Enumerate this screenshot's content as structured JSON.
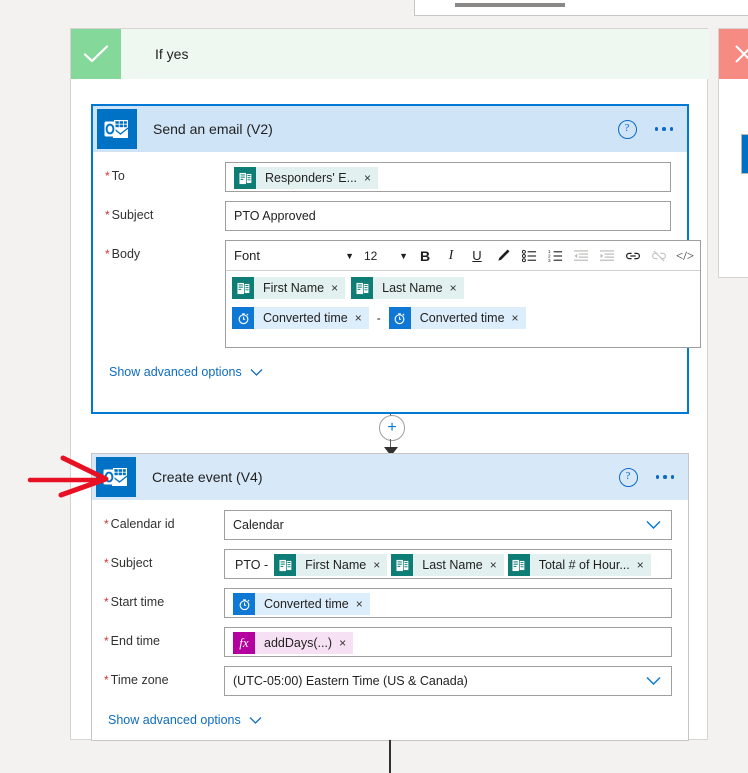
{
  "branches": {
    "yes": {
      "label": "If yes",
      "icon": "check-icon"
    },
    "no": {
      "label": "",
      "icon": "close-icon"
    }
  },
  "email_card": {
    "title": "Send an email (V2)",
    "icon": "outlook-icon",
    "help_icon": "help-icon",
    "more_icon": "ellipsis-icon",
    "fields": {
      "to": {
        "label": "To",
        "required": "*",
        "tokens": [
          {
            "text": "Responders' E...",
            "type": "forms",
            "icon": "forms-icon",
            "remove": "×"
          }
        ]
      },
      "subject": {
        "label": "Subject",
        "required": "*",
        "value": "PTO Approved"
      },
      "body": {
        "label": "Body",
        "required": "*",
        "toolbar": {
          "font_label": "Font",
          "font_caret": "▼",
          "size_label": "12",
          "size_caret": "▼",
          "bold": "B",
          "italic": "I",
          "underline": "U",
          "highlight_icon": "pen-icon",
          "bullet_list_icon": "bullet-list-icon",
          "numbered_list_icon": "numbered-list-icon",
          "outdent_icon": "outdent-icon",
          "indent_icon": "indent-icon",
          "link_icon": "link-icon",
          "unlink_icon": "unlink-icon",
          "code_icon": "code-view-icon",
          "code_label": "</>"
        },
        "lines": [
          {
            "tokens": [
              {
                "text": "First Name",
                "type": "forms",
                "icon": "forms-icon",
                "remove": "×"
              },
              {
                "text": "Last Name",
                "type": "forms",
                "icon": "forms-icon",
                "remove": "×"
              }
            ]
          },
          {
            "tokens": [
              {
                "text": "Converted time",
                "type": "time",
                "icon": "clock-icon",
                "remove": "×"
              },
              {
                "separator": "-"
              },
              {
                "text": "Converted time",
                "type": "time",
                "icon": "clock-icon",
                "remove": "×"
              }
            ]
          }
        ]
      }
    },
    "advanced_label": "Show advanced options",
    "advanced_caret": "⌄"
  },
  "connector": {
    "plus": "+",
    "plus_icon": "add-step-icon",
    "arrow_icon": "arrow-down-icon"
  },
  "event_card": {
    "title": "Create event (V4)",
    "icon": "outlook-icon",
    "help_icon": "help-icon",
    "more_icon": "ellipsis-icon",
    "fields": {
      "calendar_id": {
        "label": "Calendar id",
        "required": "*",
        "value": "Calendar",
        "caret": "⌄"
      },
      "subject": {
        "label": "Subject",
        "required": "*",
        "prefix": "PTO -",
        "tokens": [
          {
            "text": "First Name",
            "type": "forms",
            "icon": "forms-icon",
            "remove": "×"
          },
          {
            "text": "Last Name",
            "type": "forms",
            "icon": "forms-icon",
            "remove": "×"
          },
          {
            "text": "Total # of Hour...",
            "type": "forms",
            "icon": "forms-icon",
            "remove": "×"
          }
        ]
      },
      "start_time": {
        "label": "Start time",
        "required": "*",
        "tokens": [
          {
            "text": "Converted time",
            "type": "time",
            "icon": "clock-icon",
            "remove": "×"
          }
        ]
      },
      "end_time": {
        "label": "End time",
        "required": "*",
        "tokens": [
          {
            "text": "addDays(...)",
            "type": "expr",
            "icon": "function-icon",
            "glyph": "fx",
            "remove": "×"
          }
        ]
      },
      "time_zone": {
        "label": "Time zone",
        "required": "*",
        "value": "(UTC-05:00) Eastern Time (US & Canada)",
        "caret": "⌄"
      }
    },
    "advanced_label": "Show advanced options",
    "advanced_caret": "⌄"
  },
  "annotation": {
    "name": "red-arrow-annotation",
    "color": "#e81123",
    "points_at": "create-event-icon"
  },
  "colors": {
    "accent": "#0078d4",
    "branch_yes": "#84d89a",
    "branch_no": "#f58b82",
    "card_header": "#cfe4f7",
    "outlook_blue": "#0072c6",
    "forms_teal": "#0d7d75",
    "time_blue": "#0f78d4",
    "expression_magenta": "#b4009e",
    "required_red": "#d13438"
  }
}
